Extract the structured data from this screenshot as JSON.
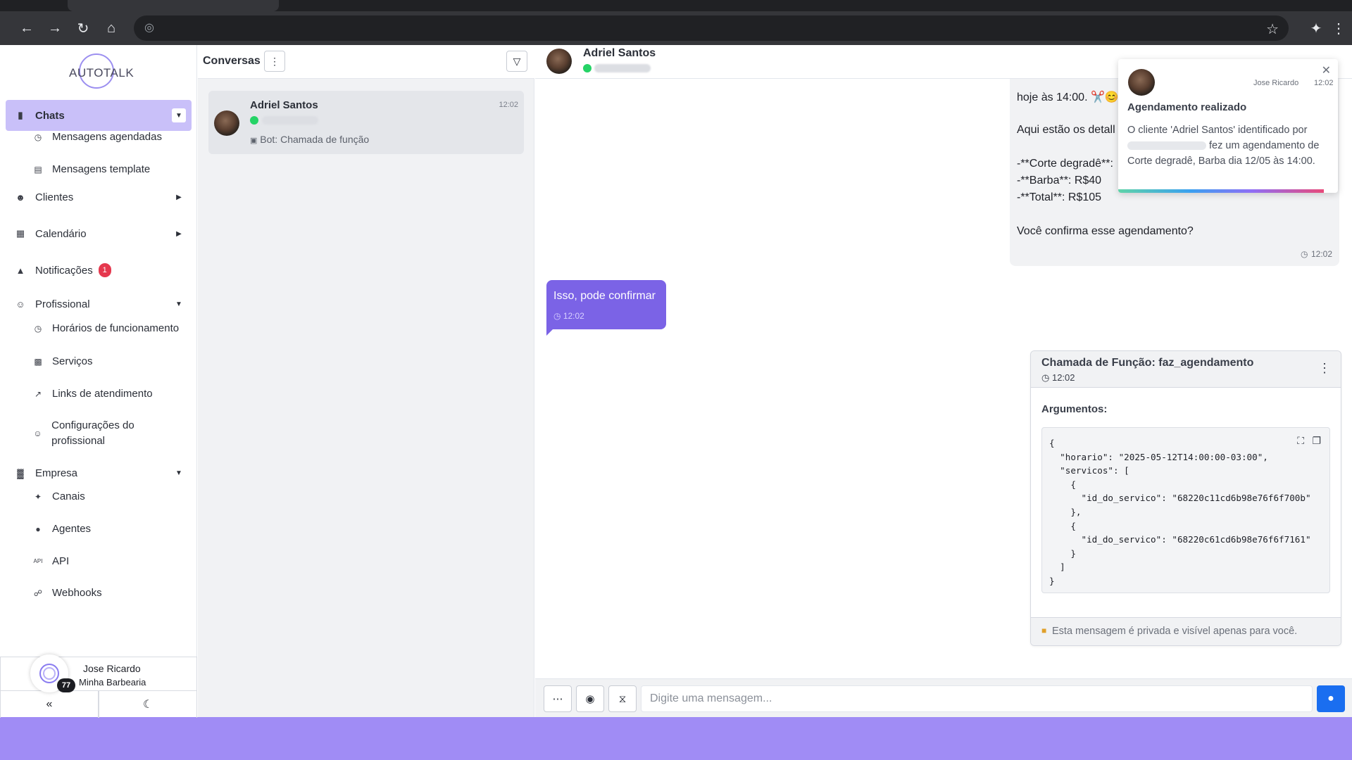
{
  "colors": {
    "accent": "#7b63e6",
    "active_nav": "#c9c0f9",
    "badge": "#e5384e",
    "primary_button": "#1a6ef0",
    "whatsapp": "#25d366"
  },
  "browser": {
    "icons": [
      "back-icon",
      "forward-icon",
      "reload-icon",
      "home-icon",
      "globe-icon",
      "star-icon",
      "extensions-icon",
      "menu-icon"
    ]
  },
  "sidebar": {
    "logo": "AUTOTALK",
    "items": [
      {
        "label": "Chats",
        "icon": "chat-icon"
      },
      {
        "label": "Mensagens agendadas",
        "icon": "clock-icon"
      },
      {
        "label": "Mensagens template",
        "icon": "template-icon"
      },
      {
        "label": "Clientes",
        "icon": "users-icon"
      },
      {
        "label": "Calendário",
        "icon": "calendar-icon"
      },
      {
        "label": "Notificações",
        "icon": "bell-icon",
        "badge": "1"
      },
      {
        "label": "Profissional",
        "icon": "user-gear-icon"
      },
      {
        "label": "Horários de funcionamento",
        "icon": "clock-icon"
      },
      {
        "label": "Serviços",
        "icon": "clipboard-icon"
      },
      {
        "label": "Links de atendimento",
        "icon": "external-link-icon"
      },
      {
        "label": "Configurações do profissional",
        "icon": "user-gear-icon"
      },
      {
        "label": "Empresa",
        "icon": "building-icon"
      },
      {
        "label": "Canais",
        "icon": "satellite-icon"
      },
      {
        "label": "Agentes",
        "icon": "robot-icon"
      },
      {
        "label": "API",
        "icon": "api-icon"
      },
      {
        "label": "Webhooks",
        "icon": "webhook-icon"
      }
    ],
    "user": {
      "name": "Jose Ricardo",
      "company": "Minha Barbearia",
      "count": "77"
    }
  },
  "conversations": {
    "title": "Conversas",
    "items": [
      {
        "name": "Adriel Santos",
        "time": "12:02",
        "preview": "Bot: Chamada de função"
      }
    ]
  },
  "chat": {
    "contact_name": "Adriel Santos",
    "incoming": {
      "lines": [
        "hoje às 14:00. ✂️😊",
        "Aqui estão os detall",
        "-**Corte degradê**:",
        "-**Barba**: R$40",
        "-**Total**: R$105",
        "Você confirma esse agendamento?"
      ],
      "time": "12:02"
    },
    "outgoing": {
      "text": "Isso, pode confirmar",
      "time": "12:02"
    },
    "function_call": {
      "title": "Chamada de Função: faz_agendamento",
      "time": "12:02",
      "args_label": "Argumentos:",
      "code": "{\n  \"horario\": \"2025-05-12T14:00:00-03:00\",\n  \"servicos\": [\n    {\n      \"id_do_servico\": \"68220c11cd6b98e76f6f700b\"\n    },\n    {\n      \"id_do_servico\": \"68220c61cd6b98e76f6f7161\"\n    }\n  ]\n}",
      "private_note": "Esta mensagem é privada e visível apenas para você."
    },
    "composer": {
      "placeholder": "Digite uma mensagem..."
    }
  },
  "toast": {
    "sender": "Jose Ricardo",
    "time": "12:02",
    "title": "Agendamento realizado",
    "body_part1": "O cliente 'Adriel Santos' identificado por",
    "body_part2": "fez um agendamento de Corte degradê, Barba dia 12/05 às 14:00."
  }
}
